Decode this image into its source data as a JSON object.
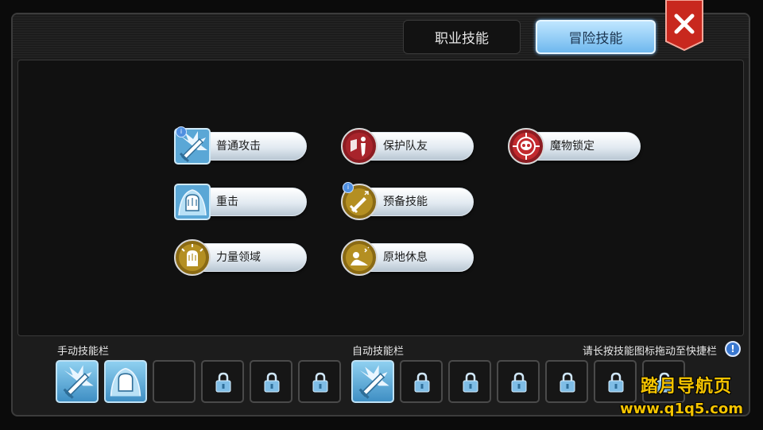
{
  "tabs": [
    {
      "label": "职业技能",
      "active": false
    },
    {
      "label": "冒险技能",
      "active": true
    }
  ],
  "close_icon": "close-x-icon",
  "skills": [
    {
      "name": "普通攻击",
      "icon": "sword-burst-icon",
      "has_info": true
    },
    {
      "name": "保护队友",
      "icon": "shield-ally-icon",
      "has_info": false
    },
    {
      "name": "魔物锁定",
      "icon": "monster-target-icon",
      "has_info": false
    },
    {
      "name": "重击",
      "icon": "fist-strike-icon",
      "has_info": false
    },
    {
      "name": "预备技能",
      "icon": "sword-ready-icon",
      "has_info": true
    },
    {
      "name": "力量领域",
      "icon": "power-fist-icon",
      "has_info": false
    },
    {
      "name": "原地休息",
      "icon": "rest-icon",
      "has_info": false
    }
  ],
  "info_mark": "i",
  "manual_bar": {
    "label": "手动技能栏",
    "slots": [
      "sword-burst-icon",
      "fist-strike-icon",
      "empty",
      "lock-icon",
      "lock-icon",
      "lock-icon"
    ]
  },
  "auto_bar": {
    "label": "自动技能栏",
    "slots": [
      "sword-burst-icon",
      "lock-icon",
      "lock-icon",
      "lock-icon",
      "lock-icon",
      "lock-icon",
      "lock-icon"
    ]
  },
  "hint": {
    "text": "请长按技能图标拖动至快捷栏",
    "icon": "exclamation-icon",
    "mark": "!"
  },
  "watermark": {
    "line1": "踏月导航页",
    "line2": "www.q1q5.com"
  },
  "colors": {
    "active_tab": "#6fb8ee",
    "close_button": "#c8281e",
    "watermark": "#f5c400"
  }
}
